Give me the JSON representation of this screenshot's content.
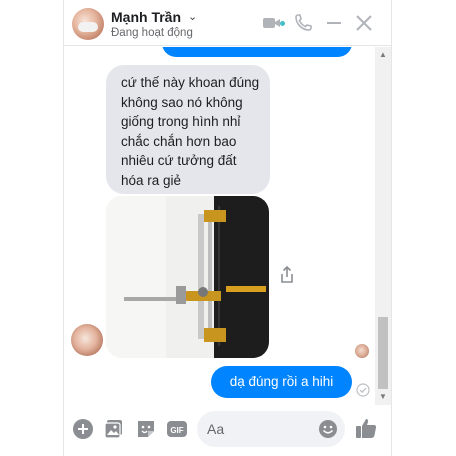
{
  "header": {
    "name": "Mạnh Trần",
    "status": "Đang hoạt động",
    "chevron": "⌄"
  },
  "messages": [
    {
      "direction": "incoming",
      "type": "text",
      "text": "cứ thế này khoan đúng không sao nó không giống trong hình nhỉ chắc chắn hơn bao nhiêu cứ tưởng đất hóa ra giẻ"
    },
    {
      "direction": "incoming",
      "type": "photo"
    },
    {
      "direction": "outgoing",
      "type": "text",
      "text": "dạ đúng rồi a hihi"
    }
  ],
  "composer": {
    "placeholder": "Aa",
    "gif_label": "GIF"
  },
  "colors": {
    "accent": "#0084ff",
    "incoming_bubble": "#e4e6eb",
    "online": "#44bec7"
  },
  "icons": [
    "video-icon",
    "phone-icon",
    "minimize-icon",
    "close-icon",
    "share-icon",
    "check-icon",
    "add-icon",
    "image-icon",
    "sticker-icon",
    "gif-icon",
    "emoji-icon",
    "like-icon"
  ]
}
